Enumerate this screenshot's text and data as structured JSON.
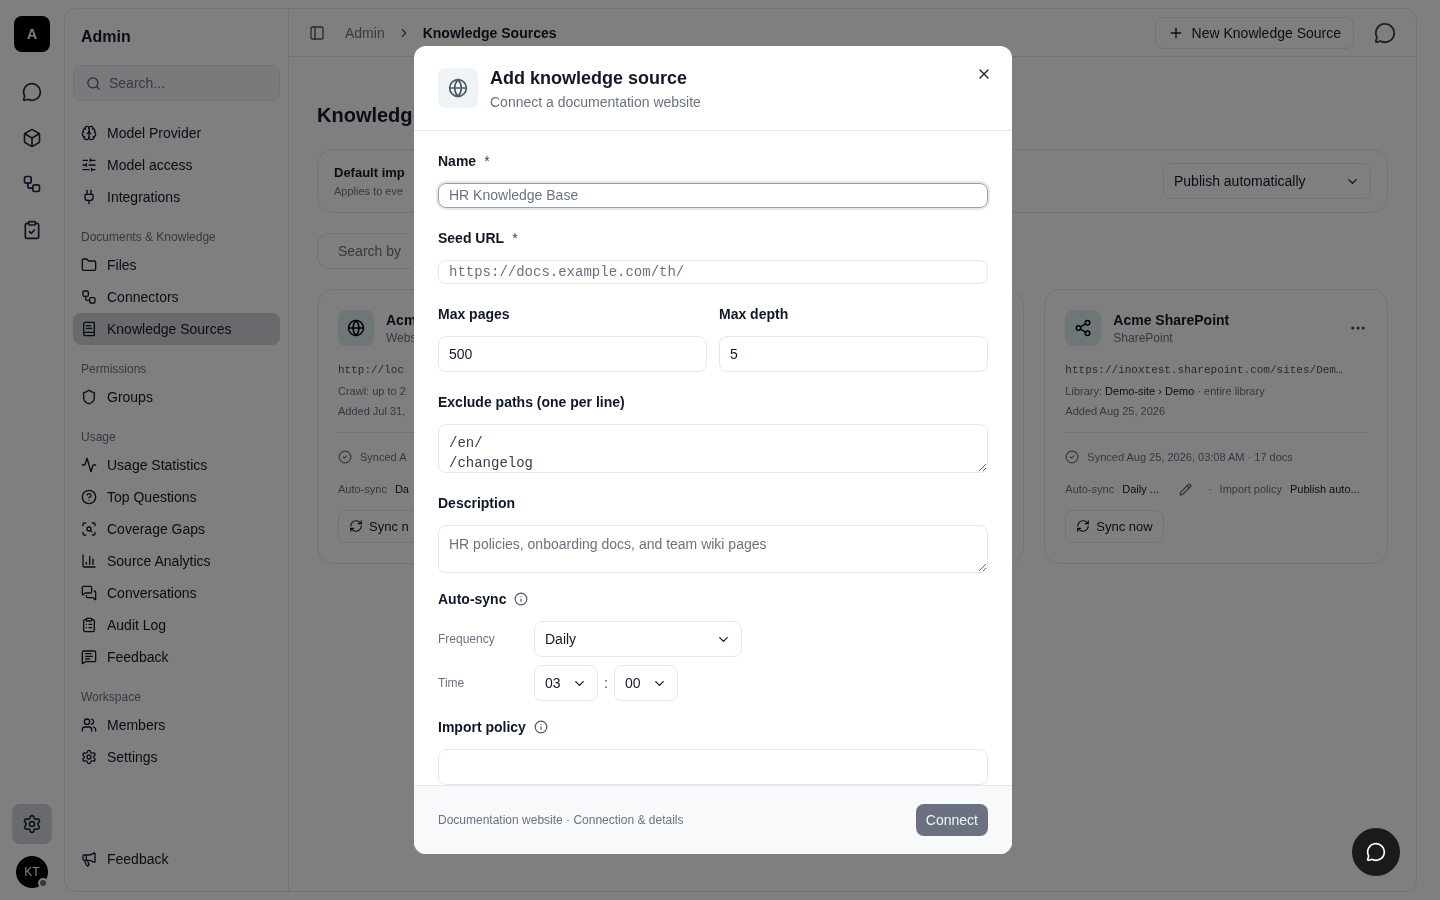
{
  "rail": {
    "logo": "A",
    "items": [
      {
        "selected": false
      },
      {
        "selected": false
      },
      {
        "selected": false
      },
      {
        "selected": false
      }
    ],
    "settings": {
      "selected": true
    },
    "avatar": {
      "initials": "KT",
      "online": true
    }
  },
  "sidebar": {
    "title": "Admin",
    "search": {
      "placeholder": "Search..."
    },
    "groups": [
      {
        "items": [
          {
            "label": "Model Provider",
            "selected": false
          },
          {
            "label": "Model access",
            "selected": false
          },
          {
            "label": "Integrations",
            "selected": false
          }
        ]
      },
      {
        "heading": "Documents & Knowledge",
        "items": [
          {
            "label": "Files",
            "selected": false
          },
          {
            "label": "Connectors",
            "selected": false
          },
          {
            "label": "Knowledge Sources",
            "selected": true
          }
        ]
      },
      {
        "heading": "Permissions",
        "items": [
          {
            "label": "Groups",
            "selected": false
          }
        ]
      },
      {
        "heading": "Usage",
        "items": [
          {
            "label": "Usage Statistics",
            "selected": false
          },
          {
            "label": "Top Questions",
            "selected": false
          },
          {
            "label": "Coverage Gaps",
            "selected": false
          },
          {
            "label": "Source Analytics",
            "selected": false
          },
          {
            "label": "Conversations",
            "selected": false
          },
          {
            "label": "Audit Log",
            "selected": false
          },
          {
            "label": "Feedback",
            "selected": false
          }
        ]
      },
      {
        "heading": "Workspace",
        "items": [
          {
            "label": "Members",
            "selected": false
          },
          {
            "label": "Settings",
            "selected": false
          }
        ]
      }
    ],
    "footer_item": "Feedback"
  },
  "header": {
    "breadcrumb": [
      "Admin",
      "Knowledge Sources"
    ],
    "new_button": "New Knowledge Source"
  },
  "page": {
    "title": "Knowledg",
    "default_import": {
      "title": "Default imp",
      "subtitle": "Applies to eve",
      "select": "Publish automatically"
    },
    "search": {
      "placeholder": "Search by"
    },
    "cards": [
      {
        "name": "Acm",
        "type": "Webs",
        "url": "http://loc",
        "lines": [
          "Crawl: up to 2",
          "Added Jul 31,"
        ],
        "synced": "Synced A",
        "autosync_label": "Auto-sync",
        "autosync_value": "Da",
        "sync_button": "Sync n"
      },
      {
        "name": "Acme SharePoint",
        "type": "SharePoint",
        "url": "https://inoxtest.sharepoint.com/sites/Dem…",
        "lines": [
          "Library: **Demo-site › Demo** · entire library",
          "Added Aug 25, 2026"
        ],
        "synced": "Synced Aug 25, 2026, 03:08 AM · 17 docs",
        "autosync_label": "Auto-sync",
        "autosync_value": "Daily ...",
        "separator": "·",
        "policy_label": "Import policy",
        "policy_value": "Publish auto...",
        "sync_button": "Sync now",
        "menu": true
      }
    ]
  },
  "modal": {
    "title": "Add knowledge source",
    "subtitle": "Connect a documentation website",
    "name": {
      "label": "Name",
      "required_mark": "*",
      "placeholder": "HR Knowledge Base",
      "focused": true
    },
    "seed_url": {
      "label": "Seed URL",
      "required_mark": "*",
      "placeholder": "https://docs.example.com/th/"
    },
    "max_pages": {
      "label": "Max pages",
      "value": "500"
    },
    "max_depth": {
      "label": "Max depth",
      "value": "5"
    },
    "exclude_paths": {
      "label": "Exclude paths (one per line)",
      "value": "/en/\n/changelog"
    },
    "description": {
      "label": "Description",
      "placeholder": "HR policies, onboarding docs, and team wiki pages"
    },
    "auto_sync": {
      "heading": "Auto-sync",
      "frequency_label": "Frequency",
      "frequency": "Daily",
      "time_label": "Time",
      "hour": "03",
      "time_separator": ":",
      "minute": "00"
    },
    "import_policy": {
      "heading": "Import policy"
    },
    "footer": {
      "text": "Documentation website · Connection & details",
      "connect_button": "Connect",
      "connect_disabled": true
    }
  }
}
